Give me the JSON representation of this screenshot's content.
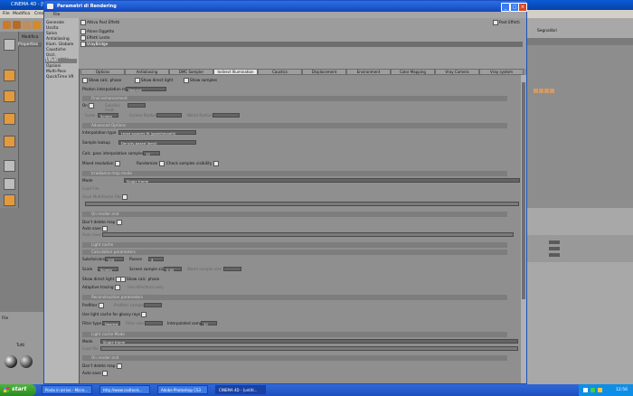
{
  "c4d": {
    "title": "CINEMA 4D - [Untitled]",
    "menu": [
      "File",
      "Modifica",
      "Crea"
    ],
    "right_menu": [
      "Segnalibri"
    ],
    "left_panel_labels": [
      "Modifica",
      "Properties"
    ],
    "bottom_labels": [
      "File",
      "Tutti"
    ]
  },
  "dialog": {
    "title": "Parametri di Rendering",
    "menu_label": "File",
    "close_glyph": "×",
    "max_glyph": "□",
    "min_glyph": "_",
    "categories": [
      "Generale",
      "Uscita",
      "Salva",
      "Antialiasing",
      "Illum. Globale",
      "Caustiche",
      "Occl. Ambientale",
      "Effetti",
      "Opzioni",
      "Multi-Pass",
      "QuickTime VR"
    ],
    "selected_category": "Effetti",
    "effects_header_left": "Attiva Post Effetti",
    "effects_header_right": "Post Effetti",
    "effects": [
      "Alone Oggetto",
      "Effetti Lente",
      "VrayBridge"
    ],
    "selected_effect": "VrayBridge",
    "tabs": [
      "Options",
      "Antialiasing",
      "DMC Sampler",
      "Indirect Illumination (GI)",
      "Caustics",
      "Displacement",
      "Environment",
      "Color Mapping",
      "Vray Camera",
      "Vray system"
    ],
    "active_tab": "Indirect Illumination (GI)",
    "content": {
      "show_calc_phase": "Show calc. phase",
      "show_direct_light": "Show direct light",
      "show_samples": "Show samples",
      "photon_interp_mode": "Photon interpolation mode",
      "photon_interp_value": "Nearest",
      "sec_final_enh": "Final enhancement",
      "on_label": "On",
      "subdivs_mult": "Subdivs mult.",
      "scale_label": "Scale",
      "scale_value": "Screen",
      "screen_radius": "Screen Radius",
      "world_radius": "World Radius",
      "sec_advanced": "Advanced Options",
      "interp_type": "Interpolation type",
      "interp_value": "Least squares fit (good/smooth)",
      "sample_lookup": "Sample lookup",
      "sample_lookup_value": "Density-based (best)",
      "calc_pass_samples": "Calc. pass interpolation samples",
      "calc_pass_value": "15",
      "multipass": "Mixed resolution",
      "randomize": "Randomize",
      "check_sample_vis": "Check samples visibility",
      "sec_irr_mode": "Irradiance map mode",
      "mode_label": "Mode",
      "mode_value": "Single frame",
      "load_file": "Load File",
      "save_multiframe": "Save Multiframe File",
      "sec_on_render_end": "On render end",
      "dont_delete": "Don't delete map",
      "auto_save": "Auto save",
      "auto_save_to": "Auto save to",
      "sec_light_cache": "Light cache",
      "sec_calc_params": "Calculation parameters",
      "subdivisions": "Subdivisions",
      "subdivisions_value": "100",
      "passes": "Passes",
      "passes_value": "4",
      "scale2": "Scale",
      "scale2_value": "Screen",
      "screen_sample_size": "Screen sample size",
      "screen_sample_value": "0.02",
      "world_sample_size": "World sample size",
      "show_direct_light2": "Show direct light",
      "show_calc_phase2": "Show calc. phase",
      "adaptive_tracing": "Adaptive tracing",
      "use_dirs_only": "Use directions only",
      "sec_recon": "Reconstruction parameters",
      "prefilter": "Prefilter",
      "prefilter_samples": "Prefilter samples",
      "use_lc_glossy": "Use light cache for glossy rays",
      "filter_type": "Filter type",
      "filter_value": "Nearest",
      "filter_size": "Filter size",
      "interp_samples": "Interpolated samples",
      "interp_samples_value": "10",
      "sec_lc_mode": "Light cache Mode",
      "mode2_label": "Mode",
      "mode2_value": "Single frame",
      "load_file2": "Load file",
      "sec_on_render_end2": "On render end",
      "dont_delete2": "Don't delete map",
      "auto_save2": "Auto save"
    }
  },
  "taskbar": {
    "start": "start",
    "tasks": [
      "Posta in arrivo - Micro...",
      "http://www.cadtools...",
      "Adobe Photoshop CS3",
      "CINEMA 4D - [untitl..."
    ],
    "active_task": "CINEMA 4D - [untitl...",
    "clock": "12:56"
  }
}
